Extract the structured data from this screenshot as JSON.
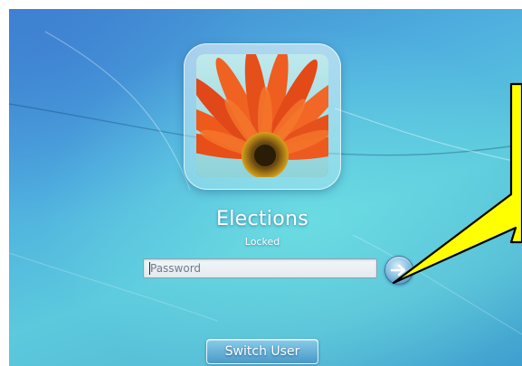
{
  "lock_screen": {
    "user_name": "Elections",
    "status": "Locked",
    "password_placeholder": "Password",
    "password_value": "",
    "switch_user_label": "Switch User"
  },
  "icons": {
    "user_tile": "flower-photo",
    "submit": "arrow-right-icon"
  },
  "colors": {
    "callout_fill": "#ffff00",
    "callout_stroke": "#000000"
  }
}
